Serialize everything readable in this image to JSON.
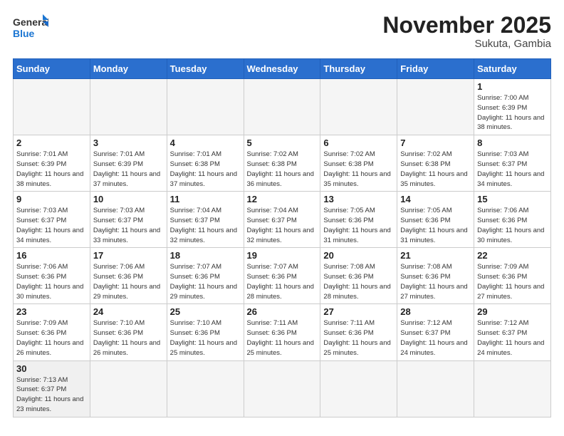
{
  "header": {
    "logo_general": "General",
    "logo_blue": "Blue",
    "month_year": "November 2025",
    "location": "Sukuta, Gambia"
  },
  "weekdays": [
    "Sunday",
    "Monday",
    "Tuesday",
    "Wednesday",
    "Thursday",
    "Friday",
    "Saturday"
  ],
  "weeks": [
    [
      {
        "day": "",
        "info": ""
      },
      {
        "day": "",
        "info": ""
      },
      {
        "day": "",
        "info": ""
      },
      {
        "day": "",
        "info": ""
      },
      {
        "day": "",
        "info": ""
      },
      {
        "day": "",
        "info": ""
      },
      {
        "day": "1",
        "info": "Sunrise: 7:00 AM\nSunset: 6:39 PM\nDaylight: 11 hours\nand 38 minutes."
      }
    ],
    [
      {
        "day": "2",
        "info": "Sunrise: 7:01 AM\nSunset: 6:39 PM\nDaylight: 11 hours\nand 38 minutes."
      },
      {
        "day": "3",
        "info": "Sunrise: 7:01 AM\nSunset: 6:39 PM\nDaylight: 11 hours\nand 37 minutes."
      },
      {
        "day": "4",
        "info": "Sunrise: 7:01 AM\nSunset: 6:38 PM\nDaylight: 11 hours\nand 37 minutes."
      },
      {
        "day": "5",
        "info": "Sunrise: 7:02 AM\nSunset: 6:38 PM\nDaylight: 11 hours\nand 36 minutes."
      },
      {
        "day": "6",
        "info": "Sunrise: 7:02 AM\nSunset: 6:38 PM\nDaylight: 11 hours\nand 35 minutes."
      },
      {
        "day": "7",
        "info": "Sunrise: 7:02 AM\nSunset: 6:38 PM\nDaylight: 11 hours\nand 35 minutes."
      },
      {
        "day": "8",
        "info": "Sunrise: 7:03 AM\nSunset: 6:37 PM\nDaylight: 11 hours\nand 34 minutes."
      }
    ],
    [
      {
        "day": "9",
        "info": "Sunrise: 7:03 AM\nSunset: 6:37 PM\nDaylight: 11 hours\nand 34 minutes."
      },
      {
        "day": "10",
        "info": "Sunrise: 7:03 AM\nSunset: 6:37 PM\nDaylight: 11 hours\nand 33 minutes."
      },
      {
        "day": "11",
        "info": "Sunrise: 7:04 AM\nSunset: 6:37 PM\nDaylight: 11 hours\nand 32 minutes."
      },
      {
        "day": "12",
        "info": "Sunrise: 7:04 AM\nSunset: 6:37 PM\nDaylight: 11 hours\nand 32 minutes."
      },
      {
        "day": "13",
        "info": "Sunrise: 7:05 AM\nSunset: 6:36 PM\nDaylight: 11 hours\nand 31 minutes."
      },
      {
        "day": "14",
        "info": "Sunrise: 7:05 AM\nSunset: 6:36 PM\nDaylight: 11 hours\nand 31 minutes."
      },
      {
        "day": "15",
        "info": "Sunrise: 7:06 AM\nSunset: 6:36 PM\nDaylight: 11 hours\nand 30 minutes."
      }
    ],
    [
      {
        "day": "16",
        "info": "Sunrise: 7:06 AM\nSunset: 6:36 PM\nDaylight: 11 hours\nand 30 minutes."
      },
      {
        "day": "17",
        "info": "Sunrise: 7:06 AM\nSunset: 6:36 PM\nDaylight: 11 hours\nand 29 minutes."
      },
      {
        "day": "18",
        "info": "Sunrise: 7:07 AM\nSunset: 6:36 PM\nDaylight: 11 hours\nand 29 minutes."
      },
      {
        "day": "19",
        "info": "Sunrise: 7:07 AM\nSunset: 6:36 PM\nDaylight: 11 hours\nand 28 minutes."
      },
      {
        "day": "20",
        "info": "Sunrise: 7:08 AM\nSunset: 6:36 PM\nDaylight: 11 hours\nand 28 minutes."
      },
      {
        "day": "21",
        "info": "Sunrise: 7:08 AM\nSunset: 6:36 PM\nDaylight: 11 hours\nand 27 minutes."
      },
      {
        "day": "22",
        "info": "Sunrise: 7:09 AM\nSunset: 6:36 PM\nDaylight: 11 hours\nand 27 minutes."
      }
    ],
    [
      {
        "day": "23",
        "info": "Sunrise: 7:09 AM\nSunset: 6:36 PM\nDaylight: 11 hours\nand 26 minutes."
      },
      {
        "day": "24",
        "info": "Sunrise: 7:10 AM\nSunset: 6:36 PM\nDaylight: 11 hours\nand 26 minutes."
      },
      {
        "day": "25",
        "info": "Sunrise: 7:10 AM\nSunset: 6:36 PM\nDaylight: 11 hours\nand 25 minutes."
      },
      {
        "day": "26",
        "info": "Sunrise: 7:11 AM\nSunset: 6:36 PM\nDaylight: 11 hours\nand 25 minutes."
      },
      {
        "day": "27",
        "info": "Sunrise: 7:11 AM\nSunset: 6:36 PM\nDaylight: 11 hours\nand 25 minutes."
      },
      {
        "day": "28",
        "info": "Sunrise: 7:12 AM\nSunset: 6:37 PM\nDaylight: 11 hours\nand 24 minutes."
      },
      {
        "day": "29",
        "info": "Sunrise: 7:12 AM\nSunset: 6:37 PM\nDaylight: 11 hours\nand 24 minutes."
      }
    ],
    [
      {
        "day": "30",
        "info": "Sunrise: 7:13 AM\nSunset: 6:37 PM\nDaylight: 11 hours\nand 23 minutes."
      },
      {
        "day": "",
        "info": ""
      },
      {
        "day": "",
        "info": ""
      },
      {
        "day": "",
        "info": ""
      },
      {
        "day": "",
        "info": ""
      },
      {
        "day": "",
        "info": ""
      },
      {
        "day": "",
        "info": ""
      }
    ]
  ]
}
